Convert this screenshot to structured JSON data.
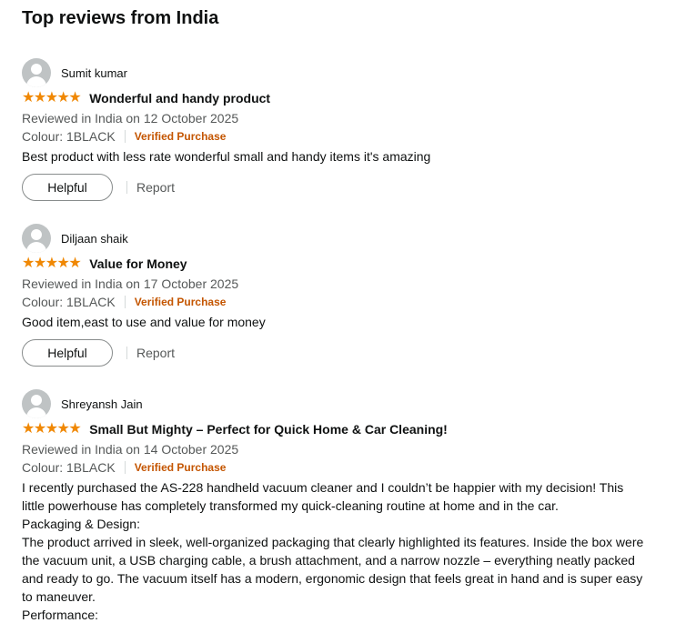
{
  "section": {
    "title": "Top reviews from India"
  },
  "colors": {
    "star": "#f08804",
    "verified": "#c45500",
    "muted_text": "#565959",
    "avatar_bg": "#bfc3c4"
  },
  "reviews": [
    {
      "author": "Sumit kumar",
      "rating": 5,
      "stars": "★★★★★",
      "title": "Wonderful and handy product",
      "date": "Reviewed in India on 12 October 2025",
      "colour": "Colour: 1BLACK",
      "verified": "Verified Purchase",
      "body": [
        "Best product with less rate wonderful small and handy items it's amazing"
      ],
      "helpful_label": "Helpful",
      "report_label": "Report",
      "avatar_icon": "user-avatar-icon"
    },
    {
      "author": "Diljaan shaik",
      "rating": 5,
      "stars": "★★★★★",
      "title": "Value for Money",
      "date": "Reviewed in India on 17 October 2025",
      "colour": "Colour: 1BLACK",
      "verified": "Verified Purchase",
      "body": [
        "Good item,east to use and value for money"
      ],
      "helpful_label": "Helpful",
      "report_label": "Report",
      "avatar_icon": "user-avatar-icon"
    },
    {
      "author": "Shreyansh Jain",
      "rating": 5,
      "stars": "★★★★★",
      "title": "Small But Mighty – Perfect for Quick Home & Car Cleaning!",
      "date": "Reviewed in India on 14 October 2025",
      "colour": "Colour: 1BLACK",
      "verified": "Verified Purchase",
      "body": [
        "I recently purchased the AS-228 handheld vacuum cleaner and I couldn’t be happier with my decision! This little powerhouse has completely transformed my quick-cleaning routine at home and in the car.",
        "Packaging & Design:",
        "The product arrived in sleek, well-organized packaging that clearly highlighted its features. Inside the box were the vacuum unit, a USB charging cable, a brush attachment, and a narrow nozzle – everything neatly packed and ready to go. The vacuum itself has a modern, ergonomic design that feels great in hand and is super easy to maneuver.",
        "Performance:"
      ],
      "avatar_icon": "user-avatar-icon"
    }
  ]
}
